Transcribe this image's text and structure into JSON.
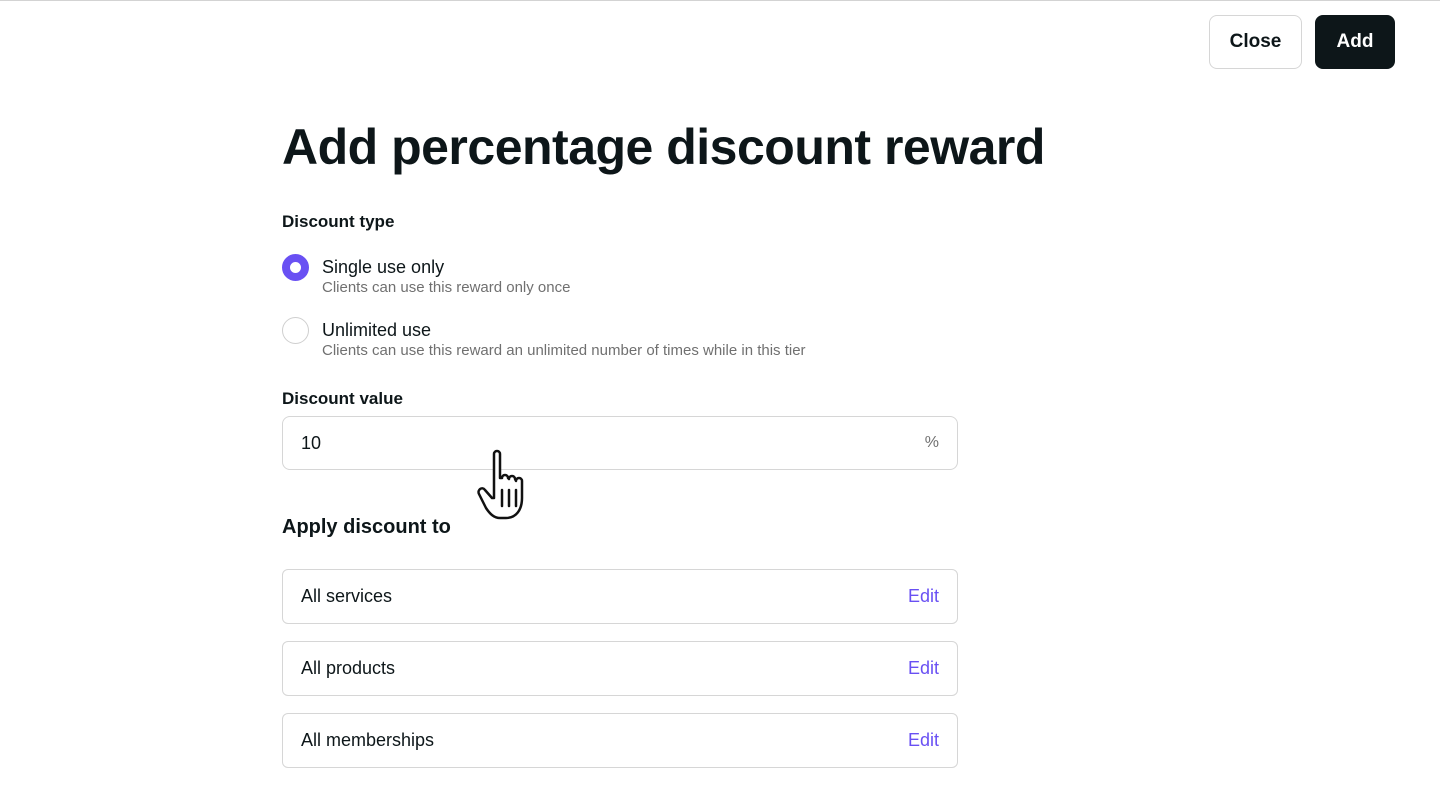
{
  "header": {
    "close_label": "Close",
    "add_label": "Add"
  },
  "page": {
    "title": "Add percentage discount reward"
  },
  "discount_type": {
    "label": "Discount type",
    "options": [
      {
        "title": "Single use only",
        "description": "Clients can use this reward only once",
        "selected": true
      },
      {
        "title": "Unlimited use",
        "description": "Clients can use this reward an unlimited number of times while in this tier",
        "selected": false
      }
    ]
  },
  "discount_value": {
    "label": "Discount value",
    "value": "10",
    "suffix": "%"
  },
  "apply_to": {
    "label": "Apply discount to",
    "items": [
      {
        "label": "All services",
        "action": "Edit"
      },
      {
        "label": "All products",
        "action": "Edit"
      },
      {
        "label": "All memberships",
        "action": "Edit"
      }
    ]
  },
  "colors": {
    "accent": "#6950f3",
    "primary_button": "#0d1619",
    "border": "#d6d6d6",
    "muted_text": "#707070"
  },
  "icons": {
    "cursor": "hand-pointer-icon"
  }
}
